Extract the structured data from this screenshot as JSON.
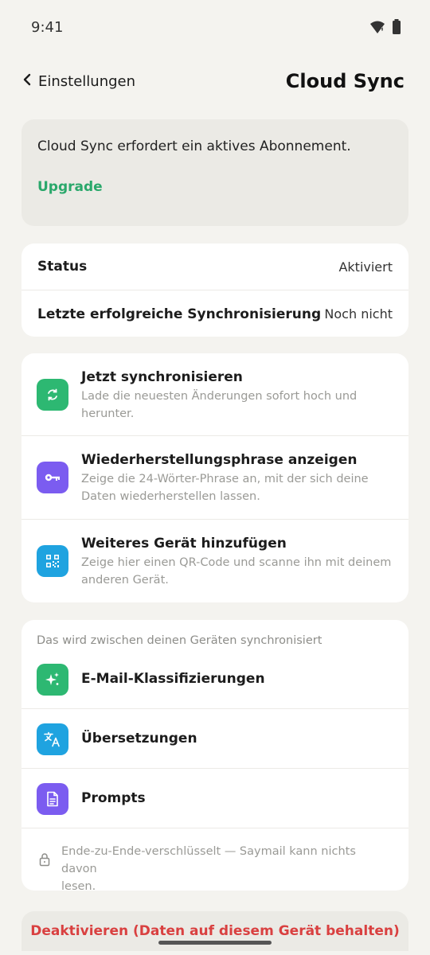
{
  "status_bar": {
    "time": "9:41"
  },
  "header": {
    "back_label": "Einstellungen",
    "title": "Cloud Sync"
  },
  "notice": {
    "text": "Cloud Sync erfordert ein aktives Abonnement.",
    "upgrade_label": "Upgrade"
  },
  "status_card": {
    "rows": [
      {
        "label": "Status",
        "value": "Aktiviert"
      },
      {
        "label": "Letzte erfolgreiche Synchronisierung",
        "value": "Noch nicht"
      }
    ]
  },
  "actions": [
    {
      "icon": "sync-icon",
      "color": "#2db872",
      "title": "Jetzt synchronisieren",
      "desc_1": "Lade die neuesten Änderungen sofort hoch und",
      "desc_2": "herunter."
    },
    {
      "icon": "key-icon",
      "color": "#7b5cf0",
      "title": "Wiederherstellungsphrase anzeigen",
      "desc_1": "Zeige die 24-Wörter-Phrase an, mit der sich deine",
      "desc_2": "Daten wiederherstellen lassen."
    },
    {
      "icon": "qr-code-icon",
      "color": "#1fa3e0",
      "title": "Weiteres Gerät hinzufügen",
      "desc_1": "Zeige hier einen QR-Code und scanne ihn mit deinem",
      "desc_2": "anderen Gerät."
    }
  ],
  "synced": {
    "caption": "Das wird zwischen deinen Geräten synchronisiert",
    "items": [
      {
        "icon": "sparkles-icon",
        "color": "#2db872",
        "label": "E-Mail-Klassifizierungen"
      },
      {
        "icon": "translate-icon",
        "color": "#1fa3e0",
        "label": "Übersetzungen"
      },
      {
        "icon": "document-icon",
        "color": "#7b5cf0",
        "label": "Prompts"
      }
    ],
    "encryption_note_1": "Ende-zu-Ende-verschlüsselt — Saymail kann nichts davon",
    "encryption_note_2": "lesen."
  },
  "deactivate_label": "Deaktivieren (Daten auf diesem Gerät behalten)"
}
